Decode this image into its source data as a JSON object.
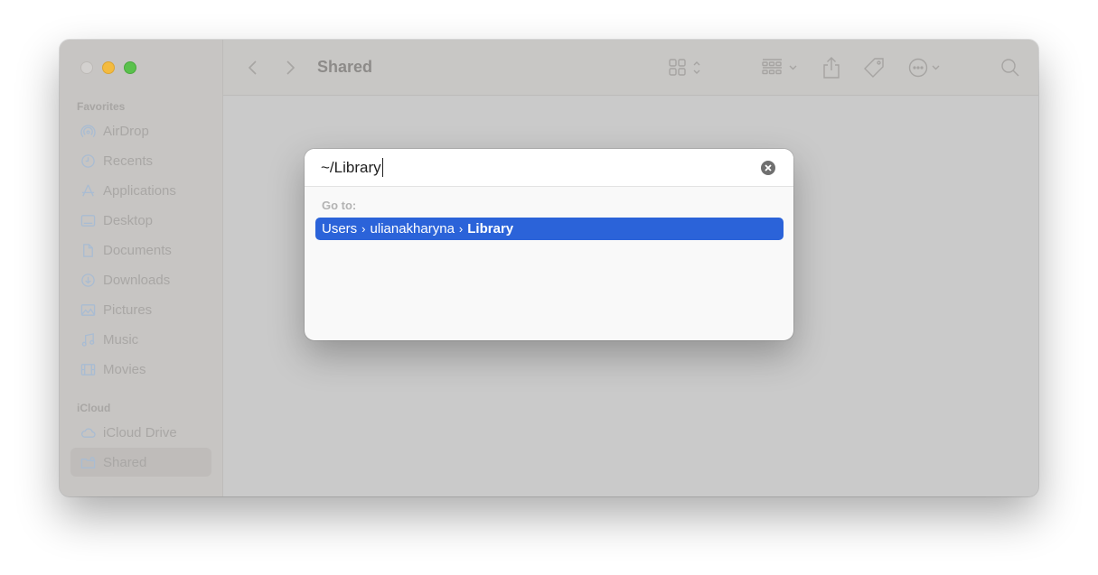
{
  "window": {
    "title": "Shared",
    "traffic_lights": {
      "close": "#d3d1cf",
      "minimize": "#f4bb3f",
      "maximize": "#5ac14c"
    }
  },
  "sidebar": {
    "sections": [
      {
        "label": "Favorites",
        "items": [
          {
            "label": "AirDrop",
            "icon": "airdrop-icon"
          },
          {
            "label": "Recents",
            "icon": "clock-icon"
          },
          {
            "label": "Applications",
            "icon": "applications-icon"
          },
          {
            "label": "Desktop",
            "icon": "desktop-icon"
          },
          {
            "label": "Documents",
            "icon": "document-icon"
          },
          {
            "label": "Downloads",
            "icon": "download-icon"
          },
          {
            "label": "Pictures",
            "icon": "photo-icon"
          },
          {
            "label": "Music",
            "icon": "music-note-icon"
          },
          {
            "label": "Movies",
            "icon": "film-icon"
          }
        ]
      },
      {
        "label": "iCloud",
        "items": [
          {
            "label": "iCloud Drive",
            "icon": "cloud-icon"
          },
          {
            "label": "Shared",
            "icon": "shared-folder-icon",
            "selected": true
          }
        ]
      }
    ]
  },
  "toolbar": {
    "back": "back-chevron-icon",
    "forward": "forward-chevron-icon",
    "title": "Shared",
    "icons": [
      "grid-view-icon",
      "group-by-icon",
      "share-icon",
      "tag-icon",
      "more-actions-icon",
      "search-icon"
    ]
  },
  "go_to_dialog": {
    "path_value": "~/Library",
    "goto_label": "Go to:",
    "result": {
      "segments": [
        "Users",
        "ulianakharyna",
        "Library"
      ],
      "separator": "›"
    },
    "accent": "#2b63d9"
  }
}
